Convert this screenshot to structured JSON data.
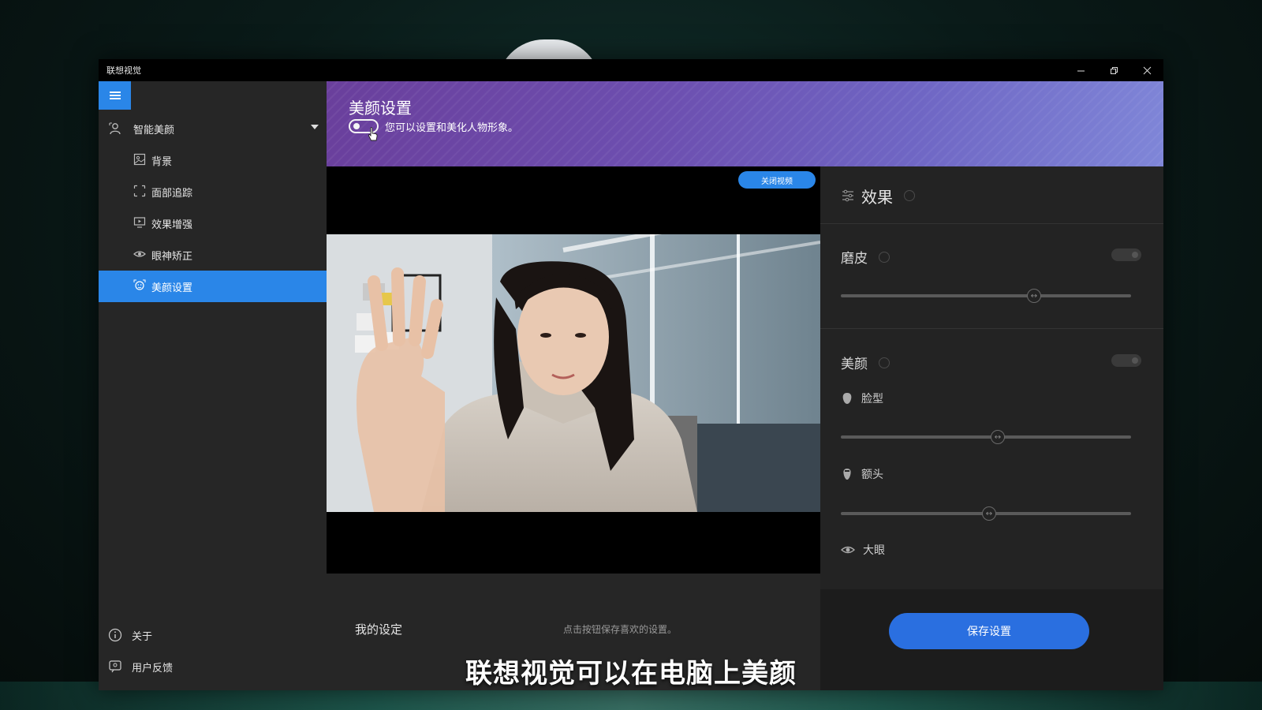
{
  "window": {
    "title": "联想视觉",
    "controls": [
      "minimize-icon",
      "restore-icon",
      "close-icon"
    ]
  },
  "sidebar": {
    "group_label": "智能美颜",
    "items": [
      {
        "label": "背景",
        "icon": "image-icon"
      },
      {
        "label": "面部追踪",
        "icon": "face-tracking-icon"
      },
      {
        "label": "效果增强",
        "icon": "monitor-icon"
      },
      {
        "label": "眼神矫正",
        "icon": "eye-icon"
      },
      {
        "label": "美颜设置",
        "icon": "beauty-icon",
        "active": true
      }
    ],
    "about_label": "关于",
    "feedback_label": "用户反馈"
  },
  "header": {
    "title": "美颜设置",
    "description": "您可以设置和美化人物形象。",
    "toggle_on": false
  },
  "video": {
    "close_button_label": "关闭视频"
  },
  "my_settings": {
    "title": "我的设定",
    "hint": "点击按钮保存喜欢的设置。"
  },
  "effects": {
    "title": "效果",
    "smoothing": {
      "label": "磨皮",
      "enabled": false,
      "value": 0.66
    },
    "beauty": {
      "label": "美颜",
      "enabled": false,
      "face_shape": {
        "label": "脸型",
        "value": 0.53
      },
      "forehead": {
        "label": "额头",
        "value": 0.5
      },
      "big_eyes": {
        "label": "大眼"
      }
    },
    "save_label": "保存设置"
  },
  "caption": "联想视觉可以在电脑上美颜",
  "colors": {
    "accent": "#2a86e8",
    "save": "#2a6fe0",
    "header_start": "#6a3f9c",
    "header_end": "#7f86d8"
  }
}
